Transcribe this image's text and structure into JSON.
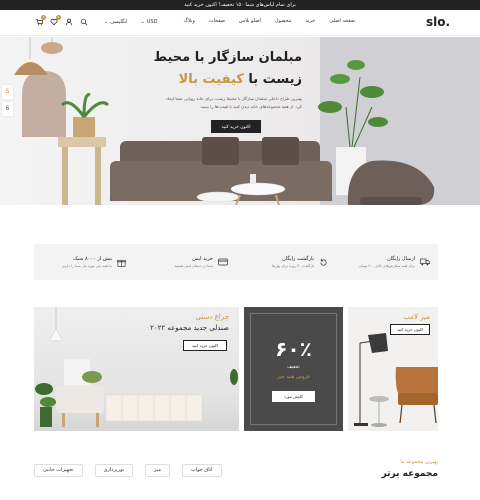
{
  "topbar": {
    "text": "برای تمام لباس‌های شما ۱۵۰ تخفیف! اکنون خرید کنید"
  },
  "header": {
    "logo": "slo.",
    "nav": [
      "صفحه اصلی",
      "خرید",
      "محصول",
      "صفحات",
      "صفحات",
      "وبلاگ"
    ],
    "nav_actual": [
      "صفحه اصلی",
      "خرید",
      "محصول",
      "اصلو بلاس",
      "صفحات",
      "وبلاگ"
    ],
    "language": "انگلیسی",
    "currency": "USD",
    "cart_count": "0",
    "wishlist_count": "0"
  },
  "hero": {
    "title_line1": "مبلمان سازگار با محیط",
    "title_line2_prefix": "زیست با",
    "title_line2_highlight": "کیفیت بالا",
    "description": "بهترین طراح داخلی مبلمان سازگار با محیط زیست برای خانه رویایی شما ایجاد کرد. از همه مجموعه‌های خانه دیدن کنید تا قیمت‌ها را ببینید",
    "button": "اکنون خرید کنید",
    "slide_numbers": [
      "5",
      "6"
    ]
  },
  "features": [
    {
      "icon": "truck-icon",
      "title": "ارسال رایگان",
      "desc": "برای همه سفارش‌های بالای ۲۰۰ تومان"
    },
    {
      "icon": "return-icon",
      "title": "بازگشت رایگان",
      "desc": "بازگشت ۳۰ روزه برای پول‌ها"
    },
    {
      "icon": "card-icon",
      "title": "خرید ایمن",
      "desc": "شما در دستان امنی هستید"
    },
    {
      "icon": "gift-icon",
      "title": "بیش از ۸۰۰۰ سبک",
      "desc": "ما همه چیز مورد نیاز شما را داریم"
    }
  ],
  "banners": {
    "lamp": {
      "category": "میز لامپ",
      "button": "اکنون خرید کنید"
    },
    "sale": {
      "percent": "۶۰٪",
      "line1": "تخفیف",
      "line2": "فروش همه چیز",
      "button": "کاوش مورد"
    },
    "chair": {
      "category": "چراغ دستی",
      "title": "صندلی جدید مجموعه ۲۰۲۲",
      "button": "اکنون خرید کنید"
    }
  },
  "collection": {
    "subtitle": "بهترین مجموعه ما",
    "title": "مجموعه برتر",
    "tabs": [
      "اتاق خواب",
      "میز",
      "نورپردازی",
      "تجهیزات جانبی"
    ]
  },
  "colors": {
    "accent": "#c8963e",
    "dark": "#222222"
  }
}
